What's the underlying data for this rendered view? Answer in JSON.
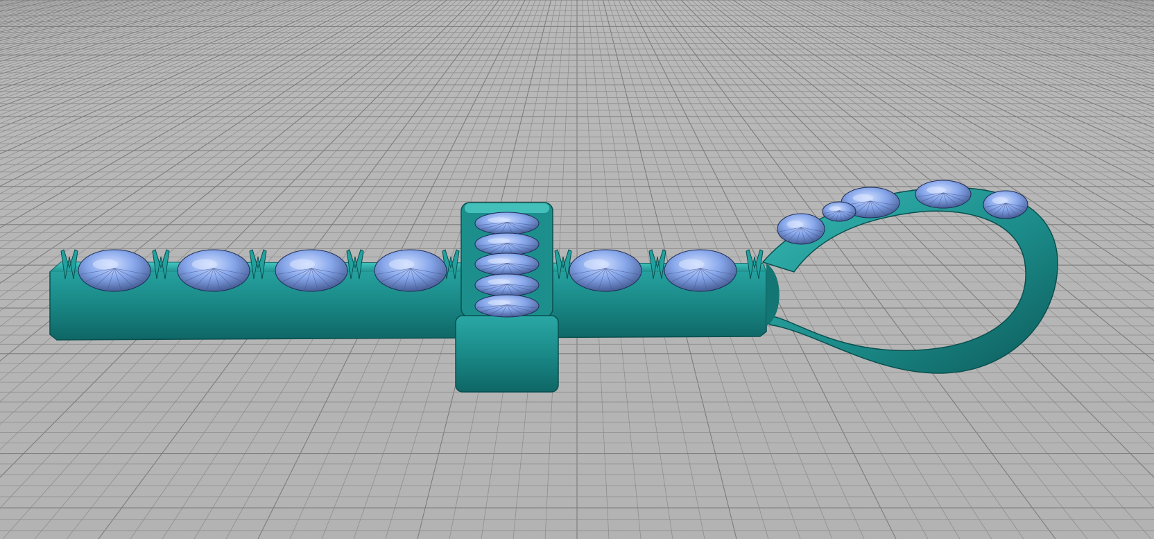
{
  "viewport": {
    "view": "perspective",
    "background": "#b8b8b8",
    "grid_color": "#8e8e8e"
  },
  "model": {
    "object": "ankh-pendant",
    "metal_color": "#1f8f8f",
    "metal_highlight": "#3fc4c0",
    "metal_shadow": "#0d5656",
    "gem_color": "#7fa0e6",
    "gem_highlight": "#c4d6ff",
    "gem_shadow": "#2b3a66",
    "gem_counts": {
      "horizontal_bar": 6,
      "vertical_bar": 5,
      "loop": 5
    }
  }
}
